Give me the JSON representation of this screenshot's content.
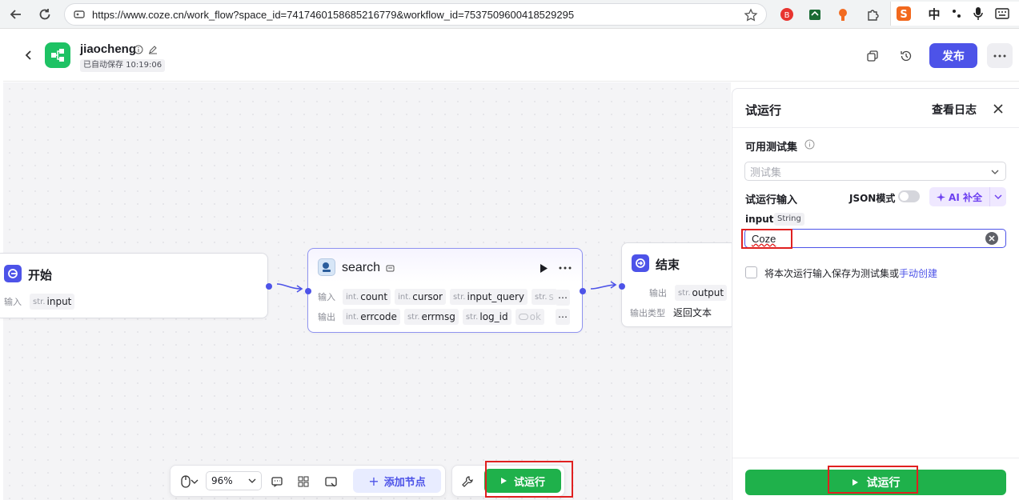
{
  "browser": {
    "url": "https://www.coze.cn/work_flow?space_id=7417460158685216779&workflow_id=7537509600418529295",
    "ime_label": "中"
  },
  "header": {
    "app_name": "jiaocheng",
    "autosave": "已自动保存 10:19:06",
    "publish_label": "发布"
  },
  "canvas": {
    "start_node": {
      "title": "开始",
      "input_label": "输入",
      "inputs": [
        {
          "type": "str.",
          "name": "input"
        }
      ]
    },
    "search_node": {
      "title": "search",
      "input_label": "输入",
      "output_label": "输出",
      "inputs": [
        {
          "type": "int.",
          "name": "count"
        },
        {
          "type": "int.",
          "name": "cursor"
        },
        {
          "type": "str.",
          "name": "input_query"
        },
        {
          "type": "str.",
          "name": "s"
        }
      ],
      "outputs": [
        {
          "type": "int.",
          "name": "errcode"
        },
        {
          "type": "str.",
          "name": "errmsg"
        },
        {
          "type": "str.",
          "name": "log_id"
        },
        {
          "type": "",
          "name": "ok"
        }
      ]
    },
    "end_node": {
      "title": "结束",
      "output_label": "输出",
      "output_type_label": "输出类型",
      "outputs": [
        {
          "type": "str.",
          "name": "output"
        }
      ],
      "output_type_value": "返回文本"
    }
  },
  "toolbar": {
    "zoom": "96%",
    "add_node_label": "添加节点",
    "run_label": "试运行"
  },
  "panel": {
    "title": "试运行",
    "view_logs": "查看日志",
    "testset_label": "可用测试集",
    "testset_placeholder": "测试集",
    "run_input_label": "试运行输入",
    "json_mode_label": "JSON模式",
    "ai_fill_label": "AI 补全",
    "param_name": "input",
    "param_type": "String",
    "param_value": "Coze",
    "save_text": "将本次运行输入保存为测试集或",
    "save_link": "手动创建",
    "run_button": "试运行"
  },
  "colors": {
    "accent": "#4d53e8",
    "run_green": "#1fb14b",
    "highlight_red": "#e02020"
  }
}
